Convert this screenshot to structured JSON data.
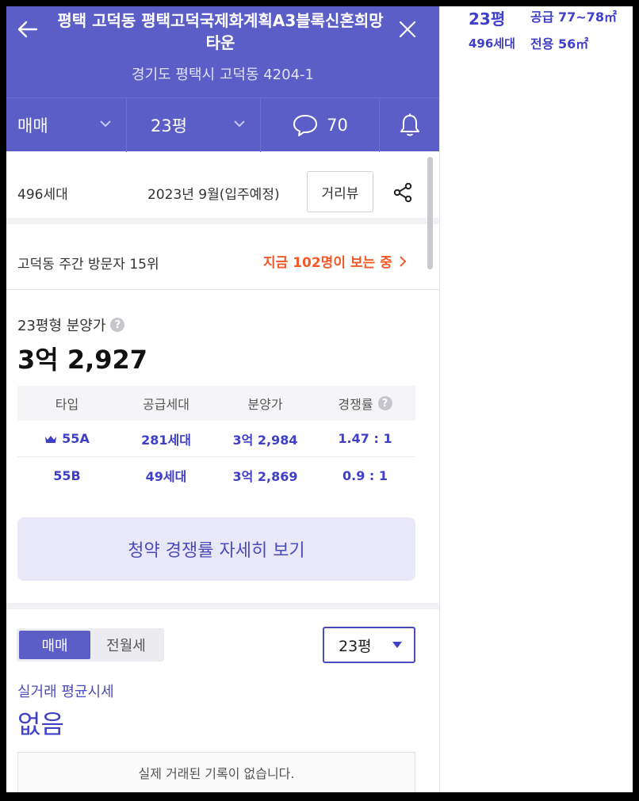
{
  "header": {
    "title": "평택 고덕동 평택고덕국제화계획A3블록신혼희망타운",
    "address": "경기도 평택시 고덕동 4204-1"
  },
  "tabbar": {
    "trade": "매매",
    "size": "23평",
    "comments": "70"
  },
  "info": {
    "units": "496세대",
    "move_in": "2023년 9월(입주예정)",
    "street_view": "거리뷰"
  },
  "visitors": {
    "rank": "고덕동 주간 방문자 15위",
    "live": "지금 102명이 보는 중"
  },
  "presale": {
    "label": "23평형 분양가",
    "price": "3억 2,927",
    "columns": [
      "타입",
      "공급세대",
      "분양가",
      "경쟁률"
    ],
    "rows": [
      {
        "type": "55A",
        "supply": "281세대",
        "price": "3억 2,984",
        "ratio": "1.47 : 1"
      },
      {
        "type": "55B",
        "supply": "49세대",
        "price": "3억 2,869",
        "ratio": "0.9 : 1"
      }
    ],
    "detail_button": "청약 경쟁률 자세히 보기"
  },
  "market": {
    "toggle": [
      "매매",
      "전월세"
    ],
    "size_select": "23평",
    "avg_label": "실거래 평균시세",
    "avg_value": "없음",
    "no_data": "실제 거래된 기록이 없습니다."
  },
  "right_panel": {
    "size": "23평",
    "supply_area": "공급 77~78㎡",
    "units": "496세대",
    "exclusive_area": "전용 56㎡"
  },
  "colors": {
    "brand": "#5b5ec6",
    "accent_text": "#3f3fc8",
    "live_orange": "#f05a28"
  }
}
